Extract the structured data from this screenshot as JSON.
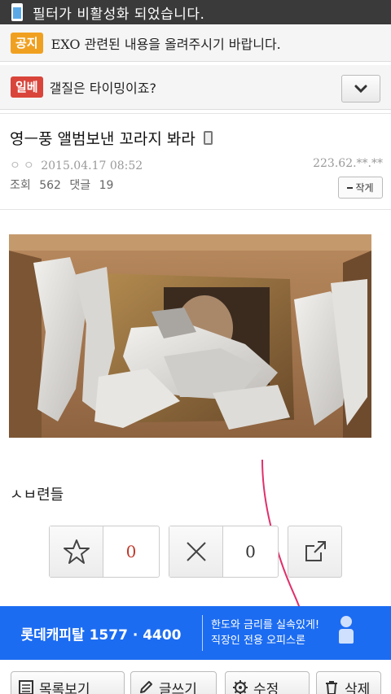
{
  "toast": {
    "icon": "phone-icon",
    "text": "필터가 비활성화 되었습니다."
  },
  "notice": {
    "badge": "공지",
    "text": "EXO 관련된 내용을 올려주시기 바랍니다."
  },
  "best": {
    "badge": "일베",
    "text": "갤질은 타이밍이죠?"
  },
  "post": {
    "title": "영ㅡ풍 앨범보낸 꼬라지 봐라",
    "date": "2015.04.17 08:52",
    "ip": "223.62.**.**",
    "views_label": "조회",
    "views": "562",
    "comments_label": "댓글",
    "comments": "19",
    "font_small_label": "작게",
    "body": "ㅅㅂ련들"
  },
  "votes": {
    "up": "0",
    "down": "0",
    "up_color": "#c0392b",
    "down_color": "#333333"
  },
  "ad": {
    "brand": "롯데캐피탈 1577 · 4400",
    "line1": "한도와 금리를 실속있게!",
    "line2": "직장인 전용 오피스론",
    "bg": "#1c6cf2"
  },
  "bottom": {
    "list": "목록보기",
    "write": "글쓰기",
    "edit": "수정",
    "delete": "삭제"
  }
}
